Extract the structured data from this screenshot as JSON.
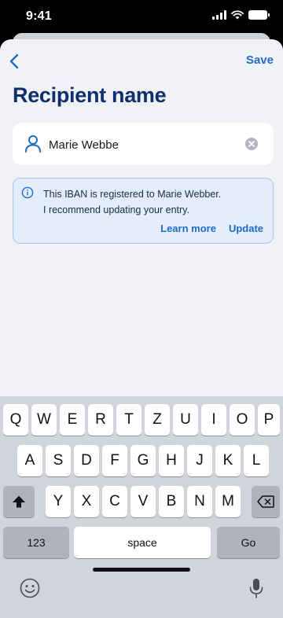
{
  "status_bar": {
    "time": "9:41"
  },
  "header": {
    "save_label": "Save"
  },
  "page": {
    "title": "Recipient name"
  },
  "name_field": {
    "value": "Marie Webbe"
  },
  "banner": {
    "line1": "This IBAN is registered to Marie Webber.",
    "line2": "I recommend updating your entry.",
    "learn_more": "Learn more",
    "update": "Update"
  },
  "keyboard": {
    "row1": [
      "Q",
      "W",
      "E",
      "R",
      "T",
      "Z",
      "U",
      "I",
      "O",
      "P"
    ],
    "row2": [
      "A",
      "S",
      "D",
      "F",
      "G",
      "H",
      "J",
      "K",
      "L"
    ],
    "row3": [
      "Y",
      "X",
      "C",
      "V",
      "B",
      "N",
      "M"
    ],
    "numbers_label": "123",
    "space_label": "space",
    "go_label": "Go"
  },
  "colors": {
    "accent": "#1f6bc9",
    "title": "#0e2f6b",
    "banner_bg": "#e3edfb"
  }
}
